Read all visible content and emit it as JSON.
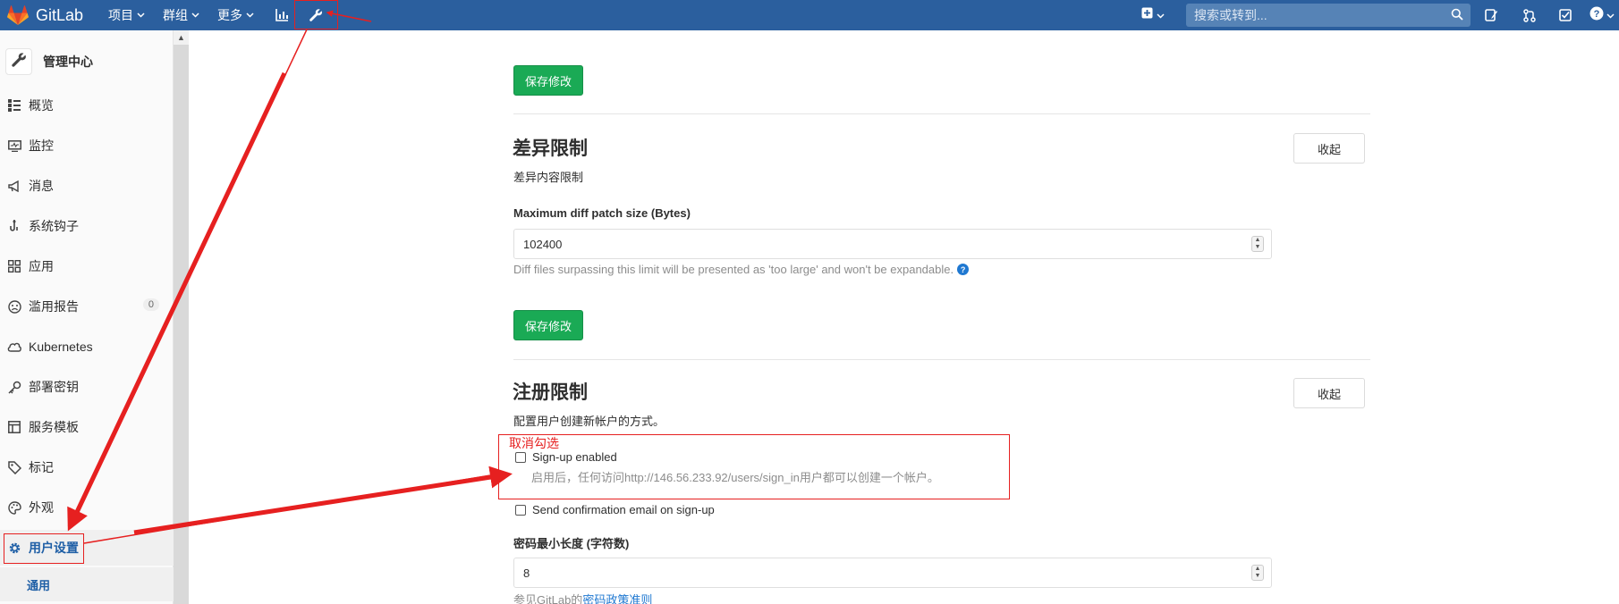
{
  "navbar": {
    "brand": "GitLab",
    "menus": [
      {
        "label": "项目"
      },
      {
        "label": "群组"
      },
      {
        "label": "更多"
      }
    ],
    "search_placeholder": "搜索或转到...",
    "icons": [
      "chart-icon",
      "wrench-icon",
      "plus-square-icon",
      "search-icon",
      "issues-icon",
      "merge-request-icon",
      "todo-icon",
      "help-icon"
    ]
  },
  "sidebar": {
    "title": "管理中心",
    "items": [
      {
        "label": "概览",
        "icon": "overview-icon"
      },
      {
        "label": "监控",
        "icon": "monitor-icon"
      },
      {
        "label": "消息",
        "icon": "messages-icon"
      },
      {
        "label": "系统钩子",
        "icon": "hook-icon"
      },
      {
        "label": "应用",
        "icon": "applications-icon"
      },
      {
        "label": "滥用报告",
        "icon": "abuse-report-icon",
        "badge": "0"
      },
      {
        "label": "Kubernetes",
        "icon": "cloud-icon"
      },
      {
        "label": "部署密钥",
        "icon": "key-icon"
      },
      {
        "label": "服务模板",
        "icon": "template-icon"
      },
      {
        "label": "标记",
        "icon": "label-icon"
      },
      {
        "label": "外观",
        "icon": "appearance-icon"
      },
      {
        "label": "用户设置",
        "icon": "settings-gear-icon",
        "active": true
      }
    ],
    "subitem": "通用"
  },
  "main": {
    "save_label": "保存修改",
    "collapse_label": "收起",
    "diff_section": {
      "title": "差异限制",
      "description": "差异内容限制",
      "field_label": "Maximum diff patch size (Bytes)",
      "field_value": "102400",
      "help": "Diff files surpassing this limit will be presented as 'too large' and won't be expandable."
    },
    "signup_section": {
      "title": "注册限制",
      "description": "配置用户创建新帐户的方式。",
      "signup_enabled_label": "Sign-up enabled",
      "signup_enabled_checked": false,
      "signup_help": "启用后，任何访问http://146.56.233.92/users/sign_in用户都可以创建一个帐户。",
      "confirm_email_label": "Send confirmation email on sign-up",
      "confirm_email_checked": false,
      "min_password_label": "密码最小长度 (字符数)",
      "min_password_value": "8",
      "password_help_prefix": "参见GitLab的",
      "password_help_link": "密码政策准则"
    }
  },
  "annotation": {
    "note": "取消勾选",
    "color": "#e62020"
  },
  "colors": {
    "navbar": "#2b5f9e",
    "save_button": "#1aaa55",
    "link": "#1f78d1",
    "active_sidebar_text": "#1f5fa6"
  }
}
